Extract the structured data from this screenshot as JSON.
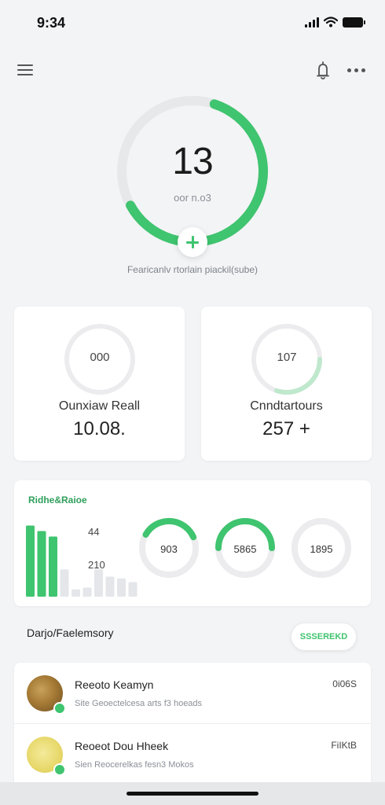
{
  "status_bar": {
    "time": "9:34"
  },
  "nav": {
    "menu_icon": "hamburger-icon",
    "bell_icon": "bell-icon",
    "more_icon": "more-icon"
  },
  "hero": {
    "value": "13",
    "unit": "oor n.o3",
    "progress": 0.62,
    "caption": "Fearicanlv rtorlain piackil(sube)",
    "accent": "#3fc46f"
  },
  "stats": [
    {
      "ring_value": "000",
      "label": "Ounxiaw Reall",
      "value": "10.08.",
      "progress": 0.0
    },
    {
      "ring_value": "107",
      "label": "Cnndtartours",
      "value": "257 +",
      "progress": 0.3
    }
  ],
  "activity": {
    "title": "Ridhe&Raioe",
    "ticks": [
      "44",
      "210"
    ],
    "bar_levels": [
      0.78,
      0.72,
      0.66,
      0.3,
      0.08,
      0.1,
      0.3,
      0.22,
      0.2,
      0.16
    ],
    "rings": [
      {
        "value": "903",
        "progress": 0.35
      },
      {
        "value": "5865",
        "progress": 0.5
      },
      {
        "value": "1895",
        "progress": 0.0
      }
    ]
  },
  "section": {
    "title": "Darjo/Faelemsory",
    "action_label": "SSSEREKD"
  },
  "list": [
    {
      "title": "Reeoto Keamyn",
      "subtitle": "Site Geoectelcesa arts f3 hoeads",
      "meta": "0i06S"
    },
    {
      "title": "Reoeot Dou Hheek",
      "subtitle": "Sien Reocerelkas fesn3 Mokos",
      "meta": "FiIKtB"
    }
  ]
}
